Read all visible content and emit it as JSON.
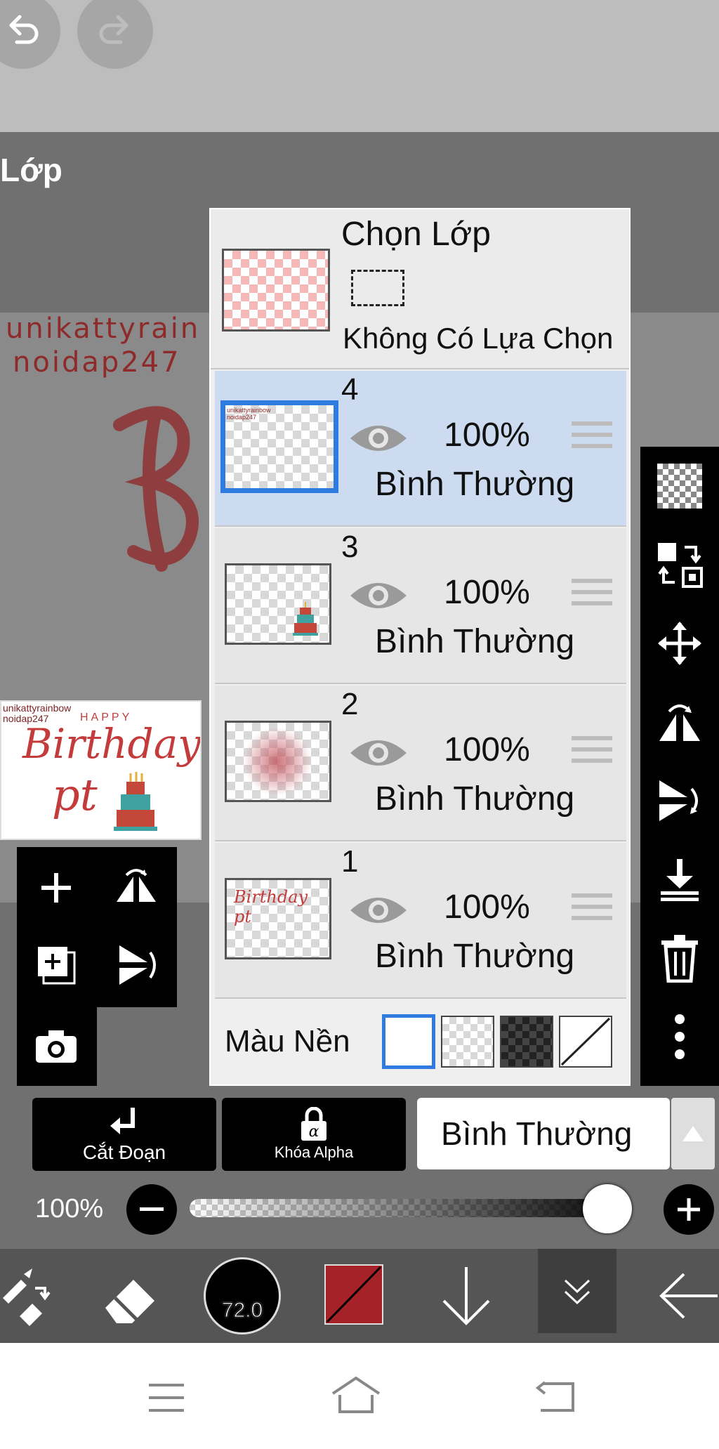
{
  "panel": {
    "title": "Lớp"
  },
  "watermark": {
    "line1": "unikattyrain",
    "line2": "noidap247"
  },
  "preview": {
    "watermark": "unikattyrainbow noidap247",
    "happy": "HAPPY",
    "birthday": "Birthday",
    "pt": "pt"
  },
  "selection": {
    "title": "Chọn Lớp",
    "status": "Không Có Lựa Chọn"
  },
  "layers": [
    {
      "num": "4",
      "opacity": "100%",
      "mode": "Bình Thường",
      "selected": true,
      "thumb_text": "unikattyrainbow noidap247"
    },
    {
      "num": "3",
      "opacity": "100%",
      "mode": "Bình Thường",
      "selected": false
    },
    {
      "num": "2",
      "opacity": "100%",
      "mode": "Bình Thường",
      "selected": false
    },
    {
      "num": "1",
      "opacity": "100%",
      "mode": "Bình Thường",
      "selected": false,
      "thumb_text": "Birthday pt"
    }
  ],
  "background": {
    "label": "Màu Nền",
    "options": [
      "white",
      "transparent",
      "dark-checker",
      "none"
    ],
    "selected": "white"
  },
  "buttons": {
    "clip": "Cắt Đoạn",
    "alpha_lock": "Khóa Alpha"
  },
  "blend_mode": {
    "value": "Bình Thường"
  },
  "opacity": {
    "label": "100%",
    "value": 100
  },
  "brush": {
    "size": "72.0"
  },
  "colors": {
    "accent": "#2f7be0",
    "primary_color": "#a52228",
    "selected_row": "#ccdbef"
  }
}
